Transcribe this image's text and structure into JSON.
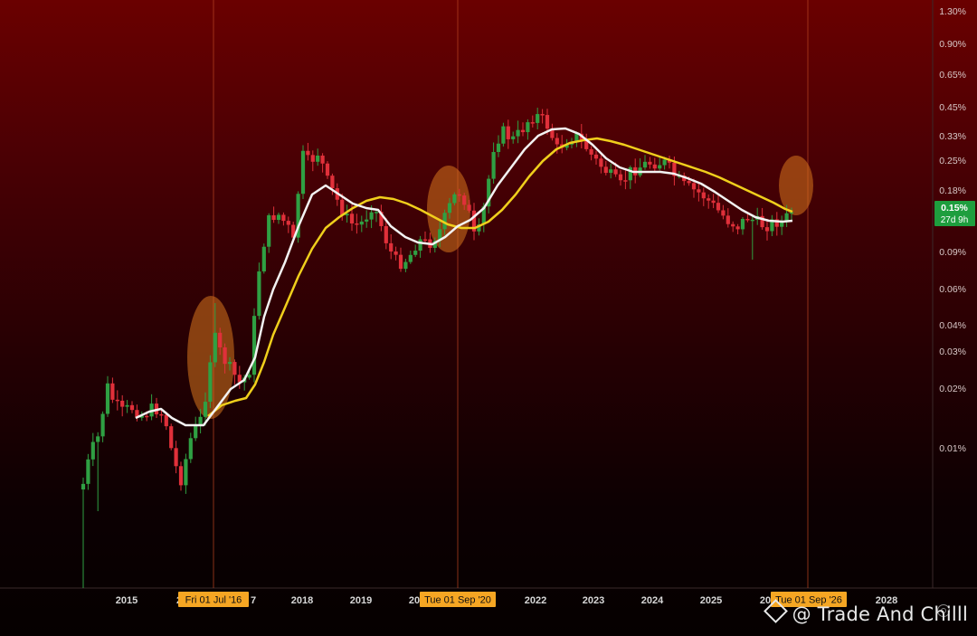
{
  "chart_data": {
    "type": "candlestick",
    "scale": "log",
    "y_ticks": [
      "1.30%",
      "0.90%",
      "0.65%",
      "0.45%",
      "0.33%",
      "0.25%",
      "0.18%",
      "0.09%",
      "0.06%",
      "0.04%",
      "0.03%",
      "0.02%",
      "0.01%"
    ],
    "x_ticks": [
      "2015",
      "2",
      "7",
      "2018",
      "2019",
      "20",
      "2022",
      "2023",
      "2024",
      "2025",
      "20",
      "2028"
    ],
    "current_price_label": "0.15%",
    "countdown_label": "27d 9h",
    "date_markers": [
      "Fri 01 Jul '16",
      "Tue 01 Sep '20",
      "Tue 01 Sep '26"
    ],
    "colors": {
      "up": "#2fa043",
      "down": "#e0303a",
      "ma_fast": "#f2f2f2",
      "ma_slow": "#f0cf1c",
      "highlight": "#d7741e",
      "marker_line": "#b3401f",
      "label_bg": "#f5a623",
      "price_badge": "#1e9e3e"
    }
  },
  "watermark": "@ Trade And Chilll"
}
